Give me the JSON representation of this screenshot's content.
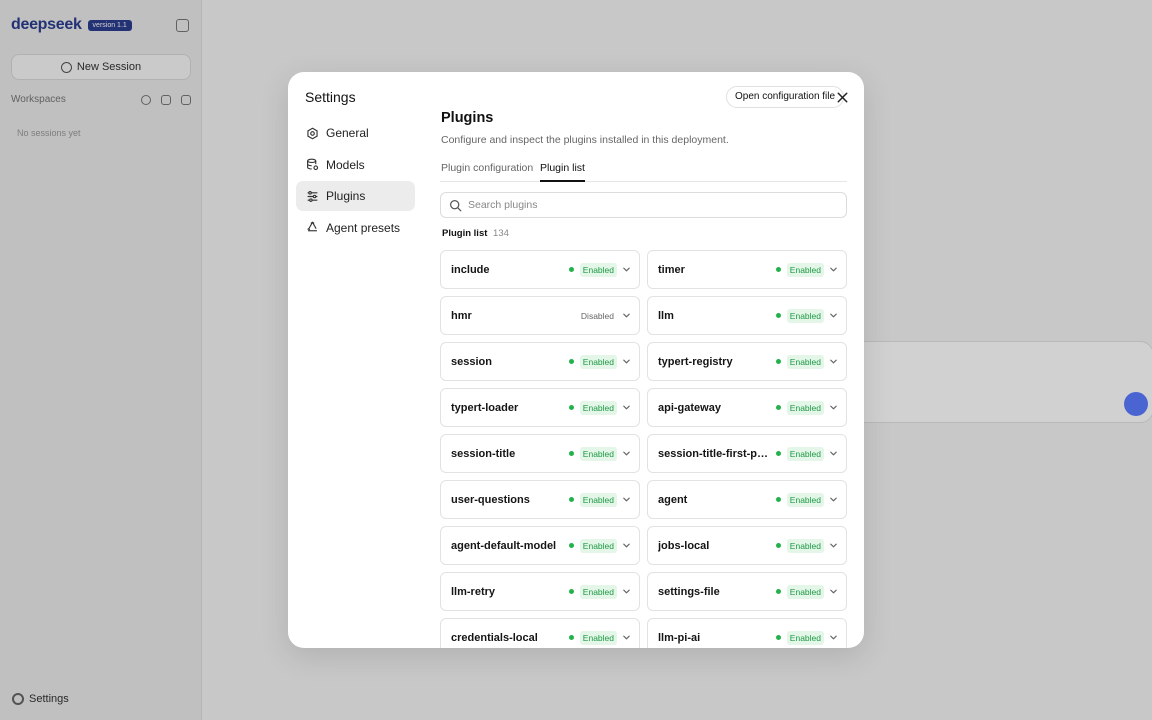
{
  "background": {
    "brand": {
      "name": "deepseek",
      "badge": "version 1.1"
    },
    "new_session_label": "New Session",
    "workspaces_label": "Workspaces",
    "no_sessions": "No sessions yet",
    "settings_label": "Settings"
  },
  "modal": {
    "title": "Settings",
    "open_config_label": "Open configuration file",
    "nav": [
      {
        "label": "General",
        "icon": "gear-icon"
      },
      {
        "label": "Models",
        "icon": "database-icon"
      },
      {
        "label": "Plugins",
        "icon": "sliders-icon",
        "active": true
      },
      {
        "label": "Agent presets",
        "icon": "recycle-icon"
      }
    ]
  },
  "plugins": {
    "title": "Plugins",
    "description": "Configure and inspect the plugins installed in this deployment.",
    "tabs": [
      "Plugin configuration",
      "Plugin list"
    ],
    "active_tab": "Plugin list",
    "search_placeholder": "Search plugins",
    "list_label": "Plugin list",
    "list_count": "134",
    "items": [
      {
        "name": "include",
        "status": "Enabled"
      },
      {
        "name": "timer",
        "status": "Enabled"
      },
      {
        "name": "hmr",
        "status": "Disabled"
      },
      {
        "name": "llm",
        "status": "Enabled"
      },
      {
        "name": "session",
        "status": "Enabled"
      },
      {
        "name": "typert-registry",
        "status": "Enabled"
      },
      {
        "name": "typert-loader",
        "status": "Enabled"
      },
      {
        "name": "api-gateway",
        "status": "Enabled"
      },
      {
        "name": "session-title",
        "status": "Enabled"
      },
      {
        "name": "session-title-first-pr…",
        "status": "Enabled"
      },
      {
        "name": "user-questions",
        "status": "Enabled"
      },
      {
        "name": "agent",
        "status": "Enabled"
      },
      {
        "name": "agent-default-model",
        "status": "Enabled"
      },
      {
        "name": "jobs-local",
        "status": "Enabled"
      },
      {
        "name": "llm-retry",
        "status": "Enabled"
      },
      {
        "name": "settings-file",
        "status": "Enabled"
      },
      {
        "name": "credentials-local",
        "status": "Enabled"
      },
      {
        "name": "llm-pi-ai",
        "status": "Enabled"
      }
    ]
  },
  "colors": {
    "enabled": "#22b24c",
    "enabled_bg": "#e3f6e8",
    "accent": "#2b3d8f"
  }
}
